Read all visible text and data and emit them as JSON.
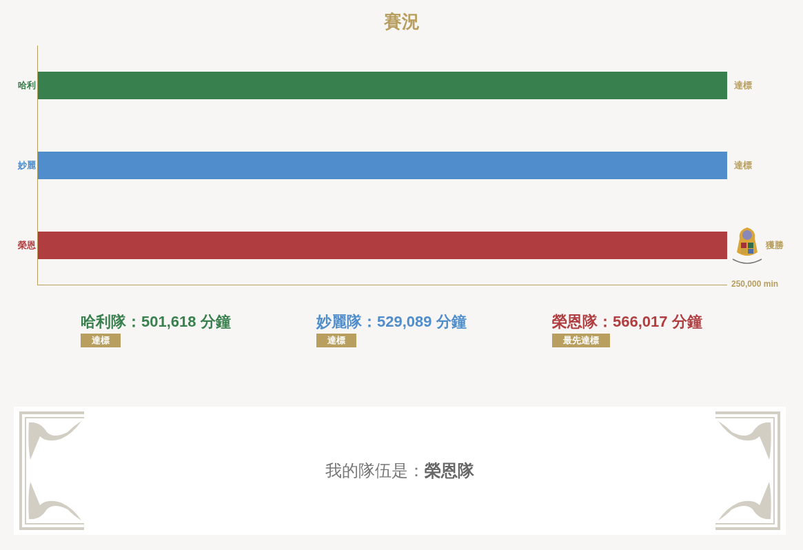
{
  "title": "賽況",
  "chart": {
    "teams": [
      {
        "name": "哈利",
        "color": "#38804d",
        "level": 1,
        "status": "達標",
        "winner": false
      },
      {
        "name": "妙麗",
        "color": "#508dcc",
        "level": 1,
        "status": "達標",
        "winner": false
      },
      {
        "name": "榮恩",
        "color": "#b03e40",
        "level": 1,
        "status": "獲勝",
        "winner": true
      }
    ],
    "axis_label": "250,000 min"
  },
  "results": [
    {
      "text": "哈利隊：501,618 分鐘",
      "badge": "達標",
      "color": "#38804d"
    },
    {
      "text": "妙麗隊：529,089 分鐘",
      "badge": "達標",
      "color": "#508dcc"
    },
    {
      "text": "榮恩隊：566,017 分鐘",
      "badge": "最先達標",
      "color": "#b03e40"
    }
  ],
  "my_team": {
    "text": "我的隊伍是：**榮恩隊**"
  }
}
